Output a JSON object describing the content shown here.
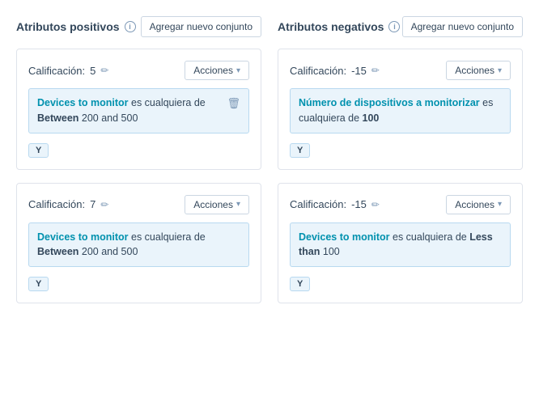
{
  "positivos": {
    "title": "Atributos positivos",
    "add_label": "Agregar nuevo conjunto",
    "cards": [
      {
        "id": "pos-1",
        "score_label": "Calificación:",
        "score_value": "5",
        "acciones_label": "Acciones",
        "condition_link": "Devices to monitor",
        "condition_mid": " es cualquiera de ",
        "condition_bold": "Between",
        "condition_rest": " 200 and 500",
        "and_label": "Y",
        "show_delete": true
      },
      {
        "id": "pos-2",
        "score_label": "Calificación:",
        "score_value": "7",
        "acciones_label": "Acciones",
        "condition_link": "Devices to monitor",
        "condition_mid": " es cualquiera de ",
        "condition_bold": "Between",
        "condition_rest": " 200 and 500",
        "and_label": "Y",
        "show_delete": false
      }
    ]
  },
  "negativos": {
    "title": "Atributos negativos",
    "add_label": "Agregar nuevo conjunto",
    "cards": [
      {
        "id": "neg-1",
        "score_label": "Calificación:",
        "score_value": "-15",
        "acciones_label": "Acciones",
        "condition_link": "Número de dispositivos a monitorizar",
        "condition_mid": " es cualquiera de ",
        "condition_bold": "100",
        "condition_rest": "",
        "and_label": "Y",
        "show_delete": false
      },
      {
        "id": "neg-2",
        "score_label": "Calificación:",
        "score_value": "-15",
        "acciones_label": "Acciones",
        "condition_link": "Devices to monitor",
        "condition_mid": " es cualquiera de ",
        "condition_bold": "Less than",
        "condition_rest": " 100",
        "and_label": "Y",
        "show_delete": false
      }
    ]
  }
}
